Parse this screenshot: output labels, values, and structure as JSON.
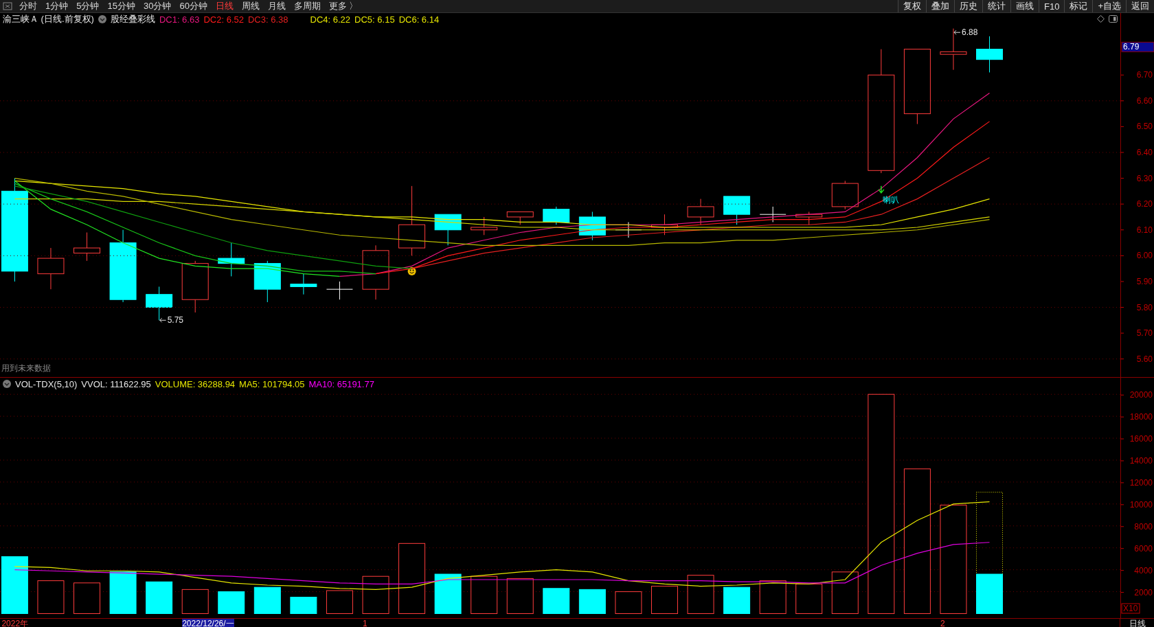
{
  "toolbar": {
    "periods": [
      {
        "label": "分时",
        "selected": false
      },
      {
        "label": "1分钟",
        "selected": false
      },
      {
        "label": "5分钟",
        "selected": false
      },
      {
        "label": "15分钟",
        "selected": false
      },
      {
        "label": "30分钟",
        "selected": false
      },
      {
        "label": "60分钟",
        "selected": false
      },
      {
        "label": "日线",
        "selected": true
      },
      {
        "label": "周线",
        "selected": false
      },
      {
        "label": "月线",
        "selected": false
      },
      {
        "label": "多周期",
        "selected": false
      },
      {
        "label": "更多 〉",
        "selected": false
      }
    ],
    "actions": [
      "复权",
      "叠加",
      "历史",
      "统计",
      "画线",
      "F10",
      "标记",
      "+自选",
      "返回"
    ]
  },
  "price_panel": {
    "title": "渝三峡Ａ (日线.前复权)",
    "overlay": "股经叠彩线",
    "legend": [
      {
        "text": "DC1: 6.63",
        "color": "#e8177f"
      },
      {
        "text": "DC2: 6.52",
        "color": "#ff1a1a"
      },
      {
        "text": "DC3: 6.38",
        "color": "#e52020"
      },
      {
        "text": "DC4: 6.22",
        "color": "#e6e600"
      },
      {
        "text": "DC5: 6.15",
        "color": "#e6e600"
      },
      {
        "text": "DC6: 6.14",
        "color": "#e6e600"
      }
    ],
    "note": "用到未来数据",
    "current_price": "6.79",
    "chart_data": {
      "type": "line",
      "ylim": [
        5.53,
        6.94
      ],
      "grid": true,
      "yticks": [
        {
          "value": 6.7,
          "label": "6.70"
        },
        {
          "value": 6.6,
          "label": "6.60"
        },
        {
          "value": 6.5,
          "label": "6.50"
        },
        {
          "value": 6.4,
          "label": "6.40"
        },
        {
          "value": 6.3,
          "label": "6.30"
        },
        {
          "value": 6.2,
          "label": "6.20"
        },
        {
          "value": 6.1,
          "label": "6.10"
        },
        {
          "value": 6.0,
          "label": "6.00"
        },
        {
          "value": 5.9,
          "label": "5.90"
        },
        {
          "value": 5.8,
          "label": "5.80"
        },
        {
          "value": 5.7,
          "label": "5.70"
        },
        {
          "value": 5.6,
          "label": "5.60"
        }
      ],
      "annotations": [
        "5.75",
        "喇叭",
        "6.88"
      ],
      "series": [
        {
          "color": "#e8177f",
          "values": [
            null,
            null,
            null,
            null,
            null,
            null,
            null,
            null,
            null,
            5.92,
            5.93,
            5.96,
            6.03,
            6.06,
            6.09,
            6.11,
            6.12,
            6.12,
            6.12,
            6.13,
            6.14,
            6.15,
            6.16,
            6.17,
            6.26,
            6.38,
            6.53,
            6.63
          ]
        },
        {
          "color": "#ff1a1a",
          "values": [
            null,
            null,
            null,
            null,
            null,
            null,
            null,
            null,
            null,
            null,
            5.93,
            5.95,
            6.0,
            6.03,
            6.06,
            6.08,
            6.1,
            6.11,
            6.11,
            6.12,
            6.13,
            6.14,
            6.14,
            6.15,
            6.21,
            6.3,
            6.42,
            6.52
          ]
        },
        {
          "color": "#e52020",
          "values": [
            null,
            null,
            null,
            null,
            null,
            null,
            null,
            null,
            null,
            null,
            null,
            5.95,
            5.98,
            6.01,
            6.03,
            6.05,
            6.07,
            6.08,
            6.09,
            6.1,
            6.11,
            6.12,
            6.12,
            6.13,
            6.16,
            6.22,
            6.3,
            6.38
          ]
        },
        {
          "color": "#e6e600",
          "values": [
            6.29,
            6.28,
            6.27,
            6.26,
            6.24,
            6.23,
            6.21,
            6.19,
            6.17,
            6.16,
            6.15,
            6.15,
            6.14,
            6.14,
            6.13,
            6.13,
            6.12,
            6.12,
            6.11,
            6.11,
            6.11,
            6.11,
            6.11,
            6.11,
            6.12,
            6.15,
            6.18,
            6.22
          ]
        },
        {
          "color": "#d8d800",
          "values": [
            6.22,
            6.22,
            6.22,
            6.21,
            6.21,
            6.2,
            6.19,
            6.18,
            6.17,
            6.16,
            6.15,
            6.14,
            6.13,
            6.12,
            6.11,
            6.11,
            6.1,
            6.1,
            6.1,
            6.1,
            6.1,
            6.1,
            6.1,
            6.1,
            6.1,
            6.11,
            6.13,
            6.15
          ]
        },
        {
          "color": "#b8b800",
          "values": [
            6.3,
            6.28,
            6.25,
            6.23,
            6.2,
            6.17,
            6.14,
            6.12,
            6.1,
            6.08,
            6.07,
            6.06,
            6.05,
            6.04,
            6.04,
            6.04,
            6.04,
            6.04,
            6.05,
            6.05,
            6.06,
            6.06,
            6.07,
            6.08,
            6.09,
            6.1,
            6.12,
            6.14
          ]
        },
        {
          "color": "#22e622",
          "values": [
            6.29,
            6.18,
            6.12,
            6.05,
            5.99,
            5.96,
            5.95,
            5.95,
            5.93,
            5.92,
            null,
            null,
            null,
            null,
            null,
            null,
            null,
            null,
            null,
            null,
            null,
            null,
            null,
            null,
            null,
            null,
            null,
            null
          ]
        },
        {
          "color": "#18c418",
          "values": [
            6.28,
            6.22,
            6.17,
            6.11,
            6.05,
            6.0,
            5.97,
            5.96,
            5.94,
            5.94,
            5.93,
            null,
            null,
            null,
            null,
            null,
            null,
            null,
            null,
            null,
            null,
            null,
            null,
            null,
            null,
            null,
            null,
            null
          ]
        },
        {
          "color": "#0fa00f",
          "values": [
            6.27,
            6.24,
            6.21,
            6.17,
            6.13,
            6.09,
            6.05,
            6.02,
            6.0,
            5.98,
            5.96,
            5.95,
            null,
            null,
            null,
            null,
            null,
            null,
            null,
            null,
            null,
            null,
            null,
            null,
            null,
            null,
            null,
            null
          ]
        }
      ]
    }
  },
  "volume_panel": {
    "title": "VOL-TDX(5,10)",
    "legend": [
      {
        "text": "VVOL: 111622.95",
        "color": "#e6e6e6"
      },
      {
        "text": "VOLUME: 36288.94",
        "color": "#e6e600"
      },
      {
        "text": "MA5: 101794.05",
        "color": "#e6e600"
      },
      {
        "text": "MA10: 65191.77",
        "color": "#ff00ff"
      }
    ],
    "scale": "X10",
    "bars": [
      {
        "rising": false
      },
      {
        "rising": true
      },
      {
        "rising": true
      },
      {
        "rising": false
      },
      {
        "rising": false
      },
      {
        "rising": true
      },
      {
        "rising": false
      },
      {
        "rising": false
      },
      {
        "rising": false
      },
      {
        "rising": true
      },
      {
        "rising": true
      },
      {
        "rising": true
      },
      {
        "rising": false
      },
      {
        "rising": true
      },
      {
        "rising": true
      },
      {
        "rising": false
      },
      {
        "rising": false
      },
      {
        "rising": true
      },
      {
        "rising": true
      },
      {
        "rising": true
      },
      {
        "rising": false
      },
      {
        "rising": true
      },
      {
        "rising": true
      },
      {
        "rising": true
      },
      {
        "rising": true
      },
      {
        "rising": true
      },
      {
        "rising": true
      },
      {
        "rising": false
      }
    ],
    "chart_data": {
      "type": "bar",
      "ylim": [
        0,
        20000
      ],
      "colors": [
        "#00ffff",
        "#ff3c3c",
        "#ff3c3c",
        "#00ffff",
        "#00ffff",
        "#ff3c3c",
        "#00ffff",
        "#00ffff",
        "#00ffff",
        "#ff3c3c",
        "#ff3c3c",
        "#ff3c3c",
        "#00ffff",
        "#ff3c3c",
        "#ff3c3c",
        "#00ffff",
        "#00ffff",
        "#ff3c3c",
        "#ff3c3c",
        "#ff3c3c",
        "#00ffff",
        "#ff3c3c",
        "#ff3c3c",
        "#ff3c3c",
        "#ff3c3c",
        "#ff3c3c",
        "#ff3c3c",
        "#00ffff"
      ],
      "grid": true,
      "yticks": [
        20000,
        18000,
        16000,
        14000,
        12000,
        10000,
        8000,
        6000,
        4000,
        2000
      ],
      "values": [
        5200,
        3000,
        2800,
        3800,
        2900,
        2200,
        2000,
        2400,
        1500,
        2100,
        3400,
        6400,
        3600,
        3400,
        3200,
        2300,
        2200,
        2000,
        2500,
        3500,
        2400,
        3000,
        2700,
        3800,
        20000,
        13200,
        9900,
        3600
      ],
      "series": [
        {
          "type": "line",
          "color": "#e6e600",
          "values": [
            4300,
            4200,
            3900,
            3900,
            3800,
            3300,
            2800,
            2600,
            2500,
            2300,
            2200,
            2400,
            3200,
            3500,
            3800,
            4000,
            3800,
            3000,
            2700,
            2500,
            2600,
            2800,
            2700,
            3100,
            6500,
            8500,
            10000,
            10200
          ]
        },
        {
          "type": "line",
          "color": "#e000e0",
          "values": [
            4000,
            3900,
            3800,
            3700,
            3600,
            3500,
            3400,
            3200,
            3000,
            2800,
            2700,
            2700,
            3100,
            3100,
            3100,
            3100,
            3100,
            3000,
            3000,
            3000,
            2900,
            2900,
            2800,
            2800,
            4400,
            5500,
            6300,
            6500
          ]
        }
      ]
    }
  },
  "date_axis": {
    "period": "日线",
    "labels": [
      {
        "text": "2022年",
        "selected": false
      },
      {
        "text": "2022/12/26/一",
        "selected": true
      },
      {
        "text": "1",
        "selected": false
      },
      {
        "text": "2",
        "selected": false
      }
    ]
  }
}
